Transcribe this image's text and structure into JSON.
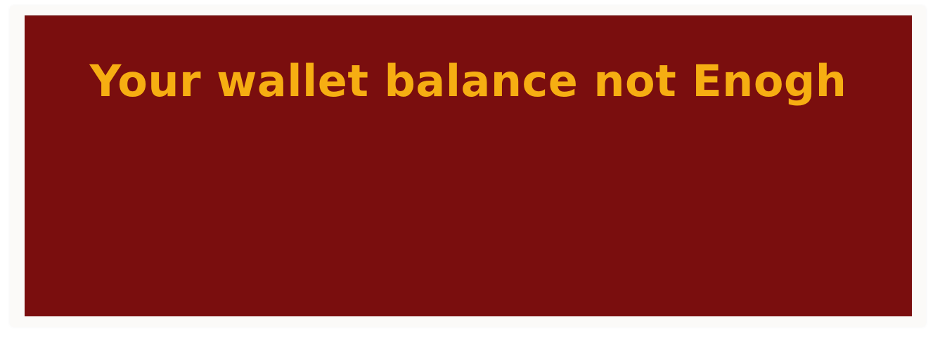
{
  "dialog": {
    "message": "Your wallet balance not Enogh"
  },
  "colors": {
    "panel_background": "#7a0e0e",
    "message_text": "#f6ae12",
    "frame_background": "#fbfaf8"
  }
}
